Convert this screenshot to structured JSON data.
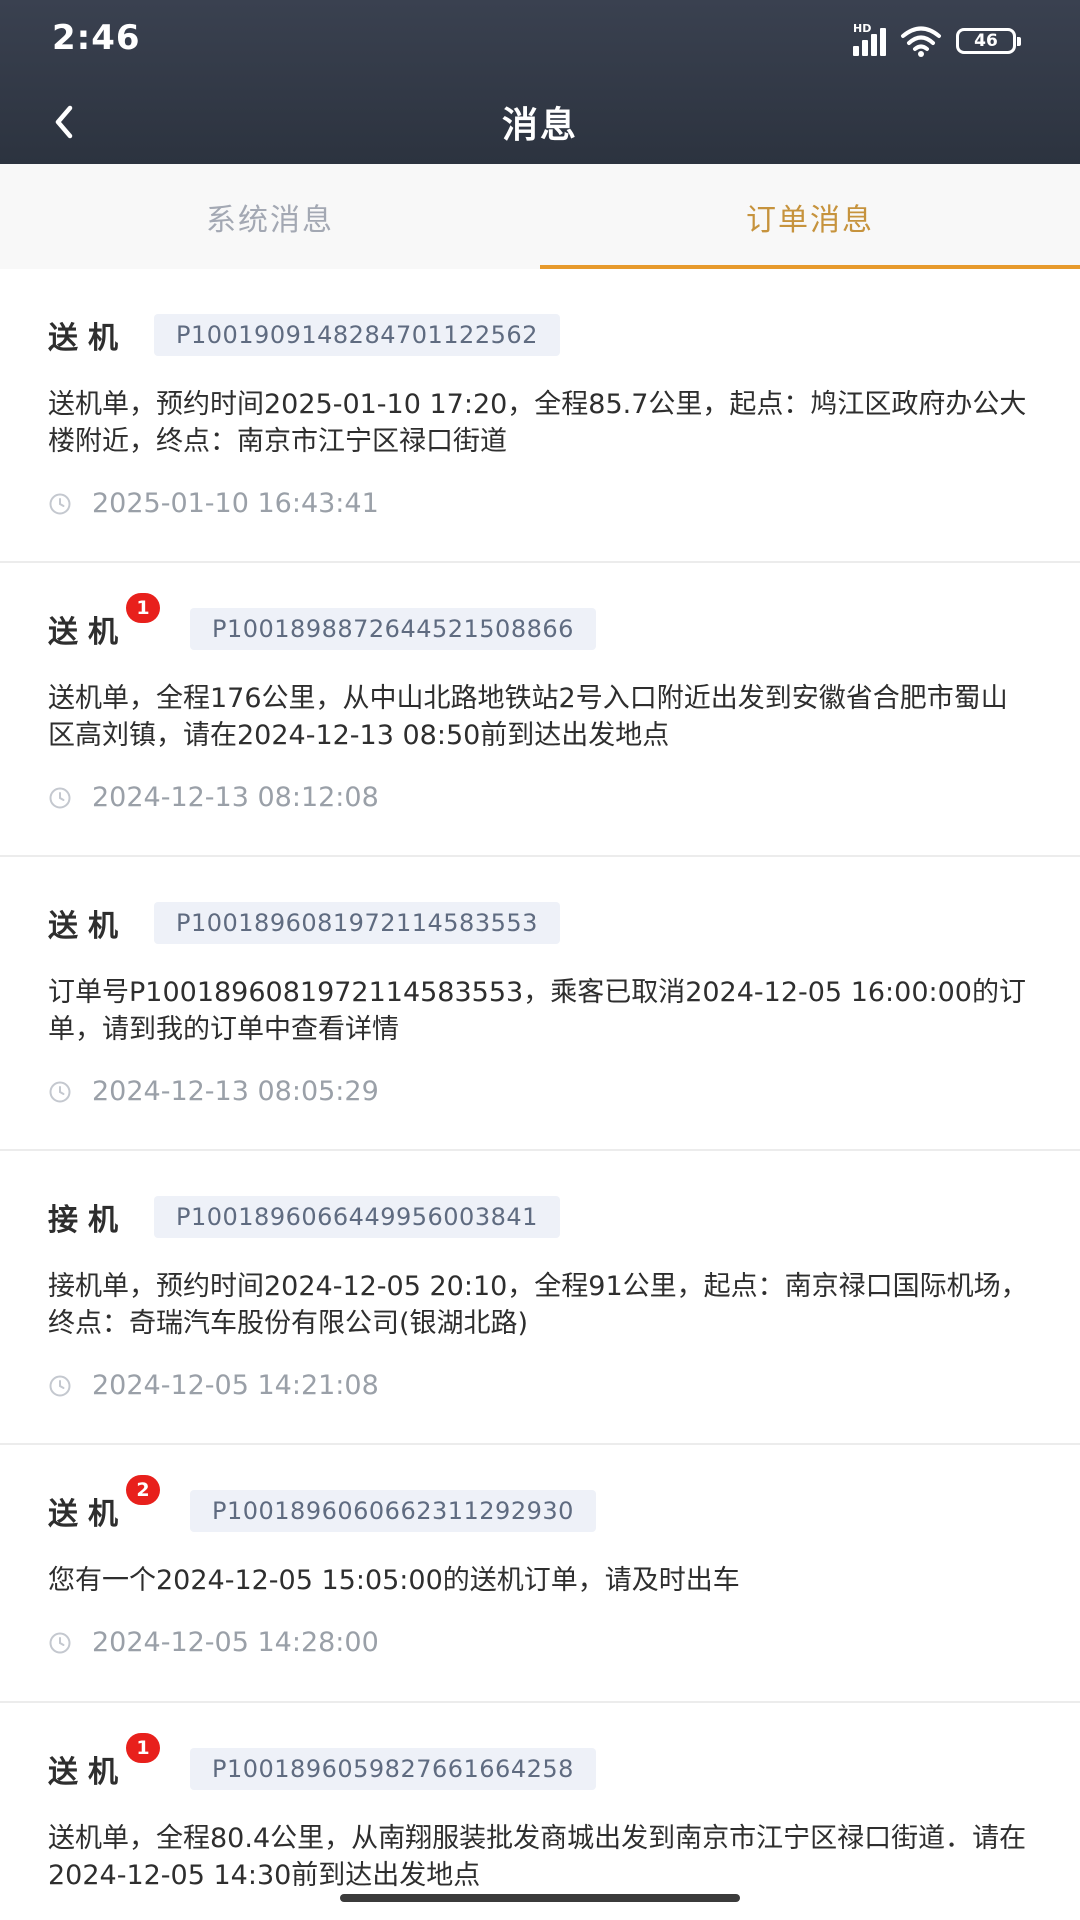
{
  "status_bar": {
    "time": "2:46",
    "battery": "46",
    "network_label": "HD"
  },
  "nav": {
    "title": "消息"
  },
  "tabs": [
    {
      "label": "系统消息",
      "active": false
    },
    {
      "label": "订单消息",
      "active": true
    }
  ],
  "colors": {
    "accent": "#e79a2c",
    "badge": "#e8201c",
    "header": "#2c333f",
    "tag_bg": "#eef1f8"
  },
  "messages": [
    {
      "type": "送机",
      "badge": "",
      "order_no": "P1001909148284701122562",
      "content": "送机单，预约时间2025-01-10 17:20，全程85.7公里，起点：鸠江区政府办公大楼附近，终点：南京市江宁区禄口街道",
      "time": "2025-01-10 16:43:41"
    },
    {
      "type": "送机",
      "badge": "1",
      "order_no": "P1001898872644521508866",
      "content": "送机单，全程176公里，从中山北路地铁站2号入口附近出发到安徽省合肥市蜀山区高刘镇，请在2024-12-13 08:50前到达出发地点",
      "time": "2024-12-13 08:12:08"
    },
    {
      "type": "送机",
      "badge": "",
      "order_no": "P1001896081972114583553",
      "content": "订单号P1001896081972114583553，乘客已取消2024-12-05 16:00:00的订单，请到我的订单中查看详情",
      "time": "2024-12-13 08:05:29"
    },
    {
      "type": "接机",
      "badge": "",
      "order_no": "P1001896066449956003841",
      "content": "接机单，预约时间2024-12-05 20:10，全程91公里，起点：南京禄口国际机场，终点：奇瑞汽车股份有限公司(银湖北路)",
      "time": "2024-12-05 14:21:08"
    },
    {
      "type": "送机",
      "badge": "2",
      "order_no": "P1001896060662311292930",
      "content": "您有一个2024-12-05 15:05:00的送机订单，请及时出车",
      "time": "2024-12-05 14:28:00"
    },
    {
      "type": "送机",
      "badge": "1",
      "order_no": "P1001896059827661664258",
      "content": "送机单，全程80.4公里，从南翔服装批发商城出发到南京市江宁区禄口街道．请在2024-12-05 14:30前到达出发地点",
      "time": ""
    }
  ]
}
